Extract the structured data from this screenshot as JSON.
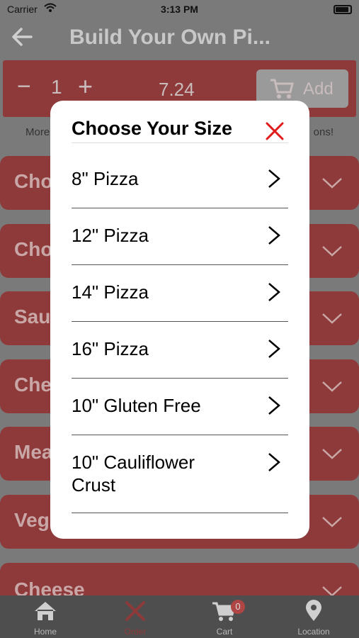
{
  "status_bar": {
    "carrier": "Carrier",
    "time": "3:13 PM"
  },
  "nav": {
    "title": "Build Your Own Pi..."
  },
  "order_bar": {
    "minus": "−",
    "quantity": "1",
    "plus": "+",
    "price": "7.24",
    "add_label": "Add"
  },
  "subtext": {
    "left": "More",
    "right": "ons!"
  },
  "sections": [
    {
      "label": "Cho"
    },
    {
      "label": "Cho"
    },
    {
      "label": "Sau"
    },
    {
      "label": "Che"
    },
    {
      "label": "Mea"
    },
    {
      "label": "Veg"
    },
    {
      "label": "Cheese"
    }
  ],
  "modal": {
    "title": "Choose Your Size",
    "options": [
      {
        "label": "8\" Pizza"
      },
      {
        "label": "12\" Pizza"
      },
      {
        "label": "14\" Pizza"
      },
      {
        "label": "16\" Pizza"
      },
      {
        "label": "10\" Gluten Free"
      },
      {
        "label": "10\" Cauliflower Crust"
      }
    ]
  },
  "tabs": [
    {
      "label": "Home",
      "icon": "home-icon"
    },
    {
      "label": "Order",
      "icon": "fork-knife-icon"
    },
    {
      "label": "Cart",
      "icon": "cart-icon",
      "badge": "0"
    },
    {
      "label": "Location",
      "icon": "map-pin-icon"
    }
  ],
  "colors": {
    "accent": "#8e3a3a",
    "close_red": "#e01b1b",
    "overlay": "#7a7a7a"
  }
}
